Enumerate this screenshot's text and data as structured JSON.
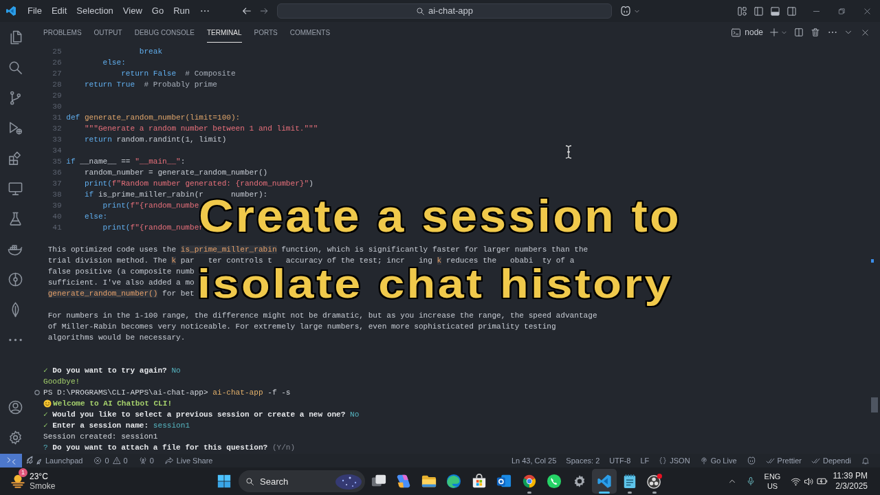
{
  "title_bar": {
    "menu": [
      "File",
      "Edit",
      "Selection",
      "View",
      "Go",
      "Run"
    ],
    "command_center": "ai-chat-app"
  },
  "panel": {
    "tabs": [
      {
        "label": "PROBLEMS",
        "selected": false
      },
      {
        "label": "OUTPUT",
        "selected": false
      },
      {
        "label": "DEBUG CONSOLE",
        "selected": false
      },
      {
        "label": "TERMINAL",
        "selected": true
      },
      {
        "label": "PORTS",
        "selected": false
      },
      {
        "label": "COMMENTS",
        "selected": false
      }
    ],
    "terminal_name": "node"
  },
  "terminal": {
    "code_lines": [
      {
        "number": "25",
        "pieces": [
          [
            {
              "text": "                break",
              "kind": "keyword"
            }
          ]
        ]
      },
      {
        "number": "26",
        "pieces": [
          [
            {
              "text": "        else:",
              "kind": "keyword"
            }
          ]
        ]
      },
      {
        "number": "27",
        "pieces": [
          [
            {
              "text": "            return False",
              "kind": "keyword"
            },
            {
              "text": "  # Composite",
              "kind": "comment"
            }
          ]
        ]
      },
      {
        "number": "28",
        "pieces": [
          [
            {
              "text": "    return True",
              "kind": "keyword"
            },
            {
              "text": "  # Probably prime",
              "kind": "comment"
            }
          ]
        ]
      },
      {
        "number": "29"
      },
      {
        "number": "30"
      },
      {
        "number": "31",
        "pieces": [
          [
            {
              "text": "def",
              "kind": "keyword"
            },
            {
              "text": " generate_random_number(limit=100):",
              "kind": "function"
            }
          ]
        ]
      },
      {
        "number": "32",
        "pieces": [
          [
            {
              "text": "    \"\"\"Generate a random number between 1 and limit.\"\"\"",
              "kind": "string"
            }
          ]
        ]
      },
      {
        "number": "33",
        "pieces": [
          [
            {
              "text": "    return",
              "kind": "keyword"
            },
            {
              "text": " random.randint(1, limit)",
              "kind": "plain"
            }
          ]
        ]
      },
      {
        "number": "34"
      },
      {
        "number": "35",
        "pieces": [
          [
            {
              "text": "if",
              "kind": "keyword"
            },
            {
              "text": " __name__ == ",
              "kind": "plain"
            },
            {
              "text": "\"__main__\"",
              "kind": "string"
            },
            {
              "text": ":",
              "kind": "plain"
            }
          ]
        ]
      },
      {
        "number": "36",
        "pieces": [
          [
            {
              "text": "    random_number = generate_random_number()",
              "kind": "plain"
            }
          ]
        ]
      },
      {
        "number": "37",
        "pieces": [
          [
            {
              "text": "    print(",
              "kind": "keyword"
            },
            {
              "text": "f\"Random number generated: {random_number}\"",
              "kind": "string"
            },
            {
              "text": ")",
              "kind": "plain"
            }
          ]
        ]
      },
      {
        "number": "38",
        "pieces": [
          [
            {
              "text": "    if",
              "kind": "keyword"
            },
            {
              "text": " is_prime_miller_rabin(r",
              "kind": "plain"
            }
          ],
          [
            {
              "text": "number):",
              "kind": "plain"
            }
          ]
        ]
      },
      {
        "number": "39",
        "pieces": [
          [
            {
              "text": "        print(",
              "kind": "keyword"
            },
            {
              "text": "f\"{random_numbe",
              "kind": "string"
            }
          ]
        ]
      },
      {
        "number": "40",
        "pieces": [
          [
            {
              "text": "    else:",
              "kind": "keyword"
            }
          ]
        ]
      },
      {
        "number": "41",
        "pieces": [
          [
            {
              "text": "        print(",
              "kind": "keyword"
            },
            {
              "text": "f\"{random_number",
              "kind": "string"
            }
          ]
        ]
      }
    ],
    "explanation": [
      {
        "pieces": [
          [
            {
              "text": "This optimized code uses the ",
              "kind": "plain"
            },
            {
              "text": "is_prime_miller_rabin",
              "kind": "code"
            },
            {
              "text": " function, which is significantly faster for larger numbers than the",
              "kind": "plain"
            }
          ]
        ]
      },
      {
        "pieces": [
          [
            {
              "text": "trial division method. The ",
              "kind": "plain"
            },
            {
              "text": "k",
              "kind": "code"
            },
            {
              "text": " par",
              "kind": "plain"
            }
          ],
          [
            {
              "text": "ter controls t",
              "kind": "plain"
            }
          ],
          [
            {
              "text": "accuracy of the test; incr",
              "kind": "plain"
            }
          ],
          [
            {
              "text": "ing ",
              "kind": "plain"
            },
            {
              "text": "k",
              "kind": "code"
            },
            {
              "text": " reduces the",
              "kind": "plain"
            }
          ],
          [
            {
              "text": "obabi",
              "kind": "plain"
            }
          ],
          [
            {
              "text": "ty of a",
              "kind": "plain"
            }
          ]
        ]
      },
      {
        "pieces": [
          [
            {
              "text": "false positive (a composite numb",
              "kind": "plain"
            }
          ]
        ]
      },
      {
        "pieces": [
          [
            {
              "text": "sufficient. I've also added a mo",
              "kind": "plain"
            }
          ]
        ]
      },
      {
        "pieces": [
          [
            {
              "text": "generate_random_number()",
              "kind": "code"
            },
            {
              "text": " for bet",
              "kind": "plain"
            }
          ]
        ]
      }
    ],
    "note": [
      "For numbers in the 1-100 range, the difference might not be dramatic, but as you increase the range, the speed advantage",
      "of Miller-Rabin becomes very noticeable. For extremely large numbers, even more sophisticated primality testing",
      "algorithms would be necessary."
    ],
    "session": [
      {
        "kind": "answered",
        "mark": "✓",
        "question": "Do you want to try again?",
        "answer": "No"
      },
      {
        "kind": "success",
        "text": "Goodbye!"
      },
      {
        "kind": "prompt",
        "prompt": "PS D:\\PROGRAMS\\CLI-APPS\\ai-chat-app>",
        "command": "ai-chat-app",
        "args": "-f -s"
      },
      {
        "kind": "welcome",
        "text": "Welcome to AI Chatbot CLI!"
      },
      {
        "kind": "answered",
        "mark": "✓",
        "question": "Would you like to select a previous session or create a new one?",
        "answer": "No"
      },
      {
        "kind": "answered",
        "mark": "✓",
        "question": "Enter a session name:",
        "answer": "session1"
      },
      {
        "kind": "message",
        "text": "Session created: session1"
      },
      {
        "kind": "pending",
        "mark": "?",
        "question": "Do you want to attach a file for this question?",
        "hint": "(Y/n)"
      }
    ]
  },
  "caption": [
    "Create a session to",
    "isolate chat history"
  ],
  "status_bar": {
    "launchpad": "Launchpad",
    "errors": "0",
    "warnings": "0",
    "ports": "0",
    "live_share": "Live Share",
    "cursor_position": "Ln 43, Col 25",
    "indentation": "Spaces: 2",
    "encoding": "UTF-8",
    "line_ending": "LF",
    "language": "JSON",
    "go_live": "Go Live",
    "prettier": "Prettier",
    "dependi": "Dependi"
  },
  "taskbar": {
    "weather": {
      "badge": "1",
      "temperature": "23°C",
      "condition": "Smoke"
    },
    "search": {
      "placeholder": "Search"
    },
    "apps": [
      {
        "running": false,
        "selected": false
      },
      {
        "running": false,
        "selected": false
      },
      {
        "running": false,
        "selected": false
      },
      {
        "running": false,
        "selected": false
      },
      {
        "running": false,
        "selected": false
      },
      {
        "running": false,
        "selected": false
      },
      {
        "running": true,
        "selected": false
      },
      {
        "running": false,
        "selected": false
      },
      {
        "running": false,
        "selected": false
      },
      {
        "running": true,
        "selected": true
      },
      {
        "running": true,
        "selected": false
      },
      {
        "running": true,
        "selected": false
      }
    ],
    "language": "ENG",
    "region": "US",
    "time": "11:39 PM",
    "date": "2/3/2025"
  }
}
